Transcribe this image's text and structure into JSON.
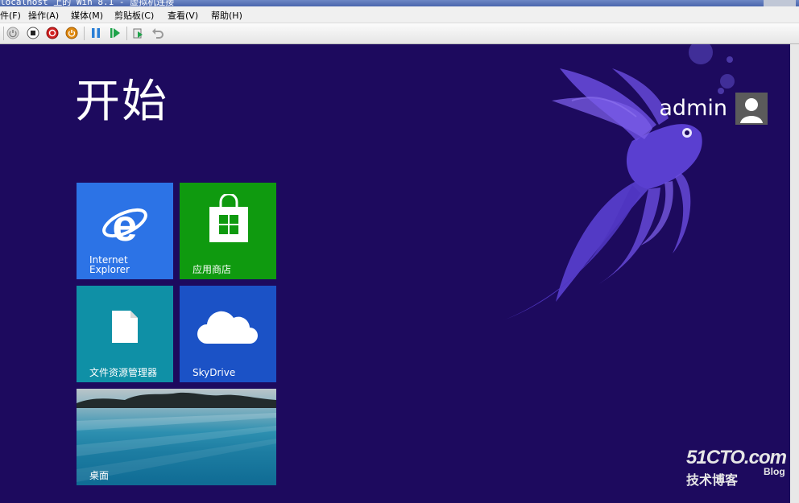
{
  "window": {
    "title": "localhost 上的 Win 8.1 - 虚拟机连接"
  },
  "menubar": {
    "items": [
      "件(F)",
      "操作(A)",
      "媒体(M)",
      "剪贴板(C)",
      "查看(V)",
      "帮助(H)"
    ]
  },
  "toolbar": {
    "icons": [
      "ctrl-alt-del-icon",
      "turn-off-icon",
      "shutdown-icon",
      "power-icon",
      "pause-icon",
      "resume-icon",
      "checkpoint-icon",
      "revert-icon"
    ]
  },
  "start": {
    "title": "开始",
    "user": "admin"
  },
  "tiles": {
    "ie": {
      "label_line1": "Internet",
      "label_line2": "Explorer",
      "color": "#2c73e6"
    },
    "store": {
      "label": "应用商店",
      "color": "#0f9a0f"
    },
    "explorer": {
      "label": "文件资源管理器",
      "color": "#0f90a6"
    },
    "skydrive": {
      "label": "SkyDrive",
      "color": "#1b52c6"
    },
    "desktop": {
      "label": "桌面"
    }
  },
  "watermark": {
    "brand": "51CTO.com",
    "sub": "技术博客",
    "blog": "Blog"
  },
  "colors": {
    "background": "#1d0a5e",
    "fish": "#5a3fd0"
  }
}
